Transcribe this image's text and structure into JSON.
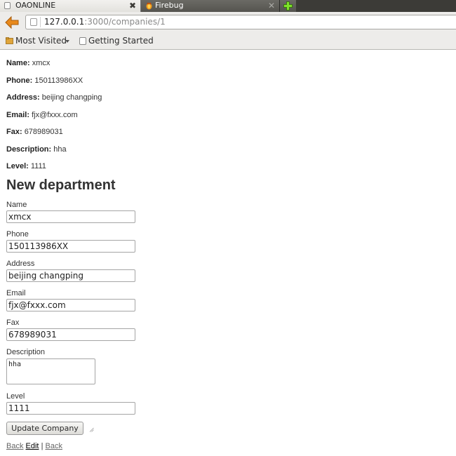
{
  "browser": {
    "tabs": [
      {
        "title": "OAONLINE",
        "close": "✖"
      },
      {
        "title": "Firebug",
        "close": "✕"
      }
    ],
    "url_host": "127.0.0.1",
    "url_path": ":3000/companies/1",
    "bookmarks": [
      {
        "label": "Most Visited"
      },
      {
        "label": "Getting Started"
      }
    ]
  },
  "company": {
    "fields": [
      {
        "label": "Name:",
        "value": "xmcx"
      },
      {
        "label": "Phone:",
        "value": "150113986XX"
      },
      {
        "label": "Address:",
        "value": "beijing changping"
      },
      {
        "label": "Email:",
        "value": "fjx@fxxx.com"
      },
      {
        "label": "Fax:",
        "value": "678989031"
      },
      {
        "label": "Description:",
        "value": "hha"
      },
      {
        "label": "Level:",
        "value": "1111"
      }
    ]
  },
  "form": {
    "heading": "New department",
    "name_label": "Name",
    "name_value": "xmcx",
    "phone_label": "Phone",
    "phone_value": "150113986XX",
    "address_label": "Address",
    "address_value": "beijing changping",
    "email_label": "Email",
    "email_value": "fjx@fxxx.com",
    "fax_label": "Fax",
    "fax_value": "678989031",
    "description_label": "Description",
    "description_value": "hha",
    "level_label": "Level",
    "level_value": "1111",
    "submit_label": "Update Company"
  },
  "links": {
    "back1": "Back",
    "edit": "Edit",
    "separator": "|",
    "back2": "Back"
  }
}
